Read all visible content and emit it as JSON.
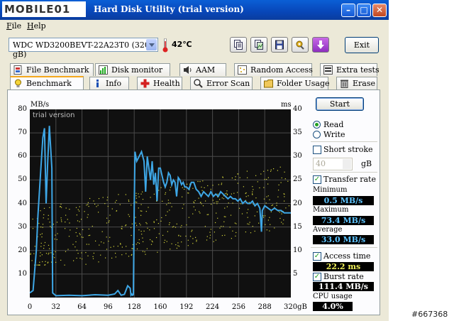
{
  "window": {
    "logo": "MOBILE01",
    "title": "Hard Disk Utility (trial version)"
  },
  "menu": [
    "File",
    "Help"
  ],
  "toolbar": {
    "drive": "WDC WD3200BEVT-22A23T0 (320 gB)",
    "temperature": "42℃",
    "exit_label": "Exit"
  },
  "tabs_top": [
    "File Benchmark",
    "Disk monitor",
    "AAM",
    "Random Access",
    "Extra tests"
  ],
  "tabs_bottom": [
    "Benchmark",
    "Info",
    "Health",
    "Error Scan",
    "Folder Usage",
    "Erase"
  ],
  "side": {
    "start_label": "Start",
    "read_label": "Read",
    "write_label": "Write",
    "short_stroke_label": "Short stroke",
    "stroke_value": "40",
    "stroke_unit": "gB",
    "transfer_rate_label": "Transfer rate",
    "minimum_label": "Minimum",
    "minimum_value": "0.5 MB/s",
    "maximum_label": "Maximum",
    "maximum_value": "73.4 MB/s",
    "average_label": "Average",
    "average_value": "33.0 MB/s",
    "access_time_label": "Access time",
    "access_time_value": "22.2 ms",
    "burst_rate_label": "Burst rate",
    "burst_rate_value": "111.4 MB/s",
    "cpu_label": "CPU usage",
    "cpu_value": "4.0%"
  },
  "watermark": "#667368",
  "chart_data": {
    "type": "line",
    "watermark": "trial version",
    "left_unit": "MB/s",
    "right_unit": "ms",
    "x_unit": "gB",
    "x_ticks": [
      "0",
      "32",
      "64",
      "96",
      "128",
      "160",
      "192",
      "224",
      "256",
      "288",
      "320gB"
    ],
    "y_left_ticks": [
      "80",
      "70",
      "60",
      "50",
      "40",
      "30",
      "20",
      "10"
    ],
    "y_right_ticks": [
      "40",
      "35",
      "30",
      "25",
      "20",
      "15",
      "10",
      "5"
    ],
    "xlim": [
      0,
      320
    ],
    "ylim": [
      0,
      80
    ],
    "y2lim": [
      0,
      40
    ],
    "grid": true,
    "series": [
      {
        "name": "Transfer rate",
        "color": "#3ea7e6",
        "points": [
          [
            0,
            2
          ],
          [
            4,
            3
          ],
          [
            8,
            20
          ],
          [
            10,
            35
          ],
          [
            13,
            52
          ],
          [
            16,
            68
          ],
          [
            18,
            72
          ],
          [
            20,
            40
          ],
          [
            22,
            58
          ],
          [
            24,
            73
          ],
          [
            27,
            55
          ],
          [
            28,
            2
          ],
          [
            32,
            0.8
          ],
          [
            48,
            1
          ],
          [
            64,
            0.8
          ],
          [
            80,
            1.2
          ],
          [
            96,
            1
          ],
          [
            104,
            1.5
          ],
          [
            108,
            3
          ],
          [
            112,
            1
          ],
          [
            116,
            1.4
          ],
          [
            120,
            5
          ],
          [
            123,
            4
          ],
          [
            124,
            1
          ],
          [
            125,
            1.5
          ],
          [
            126,
            1
          ],
          [
            127,
            1.2
          ],
          [
            128,
            38
          ],
          [
            129,
            62
          ],
          [
            131,
            58
          ],
          [
            134,
            60
          ],
          [
            137,
            62
          ],
          [
            140,
            58
          ],
          [
            142,
            45
          ],
          [
            144,
            60
          ],
          [
            146,
            55
          ],
          [
            148,
            50
          ],
          [
            150,
            58
          ],
          [
            152,
            48
          ],
          [
            154,
            53
          ],
          [
            156,
            41
          ],
          [
            158,
            55
          ],
          [
            160,
            55
          ],
          [
            162,
            52
          ],
          [
            164,
            49
          ],
          [
            166,
            47
          ],
          [
            168,
            49
          ],
          [
            170,
            53
          ],
          [
            172,
            52
          ],
          [
            174,
            48
          ],
          [
            176,
            50
          ],
          [
            178,
            49
          ],
          [
            180,
            43
          ],
          [
            182,
            51
          ],
          [
            184,
            50
          ],
          [
            186,
            48
          ],
          [
            188,
            49
          ],
          [
            190,
            47
          ],
          [
            192,
            47
          ],
          [
            195,
            46
          ],
          [
            198,
            49
          ],
          [
            201,
            49
          ],
          [
            204,
            46
          ],
          [
            207,
            45
          ],
          [
            210,
            43
          ],
          [
            213,
            45
          ],
          [
            216,
            44
          ],
          [
            219,
            43
          ],
          [
            222,
            45
          ],
          [
            225,
            43
          ],
          [
            228,
            44
          ],
          [
            231,
            43
          ],
          [
            234,
            45
          ],
          [
            237,
            44
          ],
          [
            240,
            43
          ],
          [
            243,
            42
          ],
          [
            246,
            43
          ],
          [
            249,
            42
          ],
          [
            252,
            42
          ],
          [
            255,
            41
          ],
          [
            258,
            42
          ],
          [
            261,
            40
          ],
          [
            264,
            41
          ],
          [
            267,
            40
          ],
          [
            270,
            40
          ],
          [
            273,
            41
          ],
          [
            276,
            39
          ],
          [
            279,
            40
          ],
          [
            282,
            38
          ],
          [
            284,
            28
          ],
          [
            285,
            37
          ],
          [
            288,
            39
          ],
          [
            292,
            38
          ],
          [
            296,
            37
          ],
          [
            300,
            38
          ],
          [
            304,
            37
          ],
          [
            308,
            37
          ],
          [
            312,
            36
          ],
          [
            316,
            36
          ],
          [
            320,
            36
          ]
        ]
      }
    ],
    "scatter": {
      "name": "Access time",
      "color": "#d4d43a",
      "note": "dots spread between about 8 ms and 26 ms right axis"
    }
  }
}
